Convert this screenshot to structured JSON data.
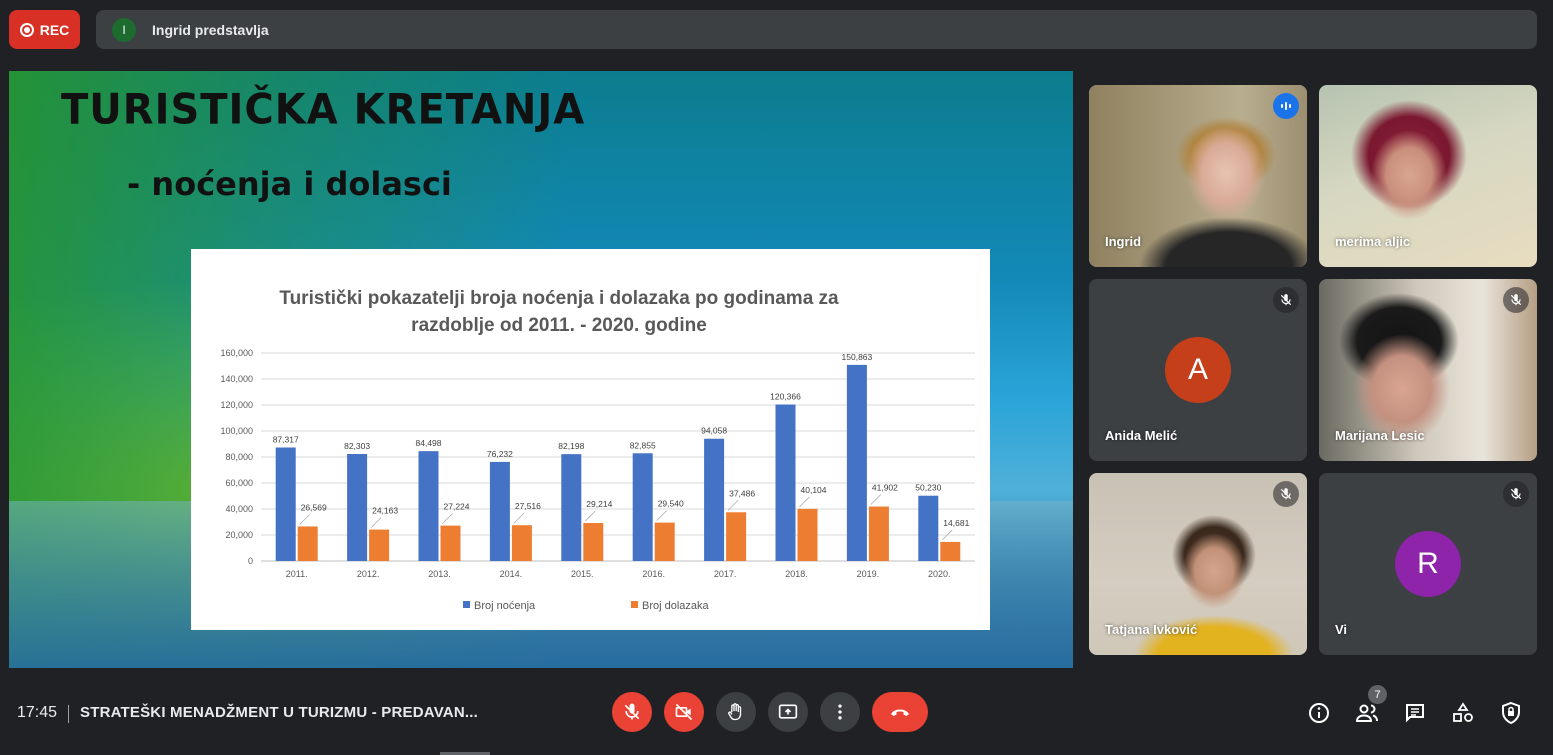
{
  "top": {
    "rec_label": "REC",
    "presenter_initial": "I",
    "presenter_text": "Ingrid predstavlja"
  },
  "slide": {
    "title": "TURISTIČKA KRETANJA",
    "subtitle": "- noćenja i dolasci"
  },
  "chart_data": {
    "type": "bar",
    "title_line1": "Turistički pokazatelji broja noćenja i dolazaka po godinama za",
    "title_line2": "razdoblje od 2011. - 2020. godine",
    "categories": [
      "2011.",
      "2012.",
      "2013.",
      "2014.",
      "2015.",
      "2016.",
      "2017.",
      "2018.",
      "2019.",
      "2020."
    ],
    "series": [
      {
        "name": "Broj noćenja",
        "color": "#4472c4",
        "values": [
          87317,
          82303,
          84498,
          76232,
          82198,
          82855,
          94058,
          120366,
          150863,
          50230
        ]
      },
      {
        "name": "Broj dolazaka",
        "color": "#ed7d31",
        "values": [
          26569,
          24163,
          27224,
          27516,
          29214,
          29540,
          37486,
          40104,
          41902,
          14681
        ]
      }
    ],
    "labels": {
      "Broj noćenja": [
        "87,317",
        "82,303",
        "84,498",
        "76,232",
        "82,198",
        "82,855",
        "94,058",
        "120,366",
        "150,863",
        "50,230"
      ],
      "Broj dolazaka": [
        "26,569",
        "24,163",
        "27,224",
        "27,516",
        "29,214",
        "29,540",
        "37,486",
        "40,104",
        "41,902",
        "14,681"
      ]
    },
    "ylim": [
      0,
      160000
    ],
    "yticks": [
      "0",
      "20,000",
      "40,000",
      "60,000",
      "80,000",
      "100,000",
      "120,000",
      "140,000",
      "160,000"
    ],
    "grid": true,
    "legend": "bottom"
  },
  "participants": [
    {
      "name": "Ingrid",
      "type": "video",
      "speaking": true
    },
    {
      "name": "merima aljic",
      "type": "video"
    },
    {
      "name": "Anida Melić",
      "type": "avatar",
      "initial": "A",
      "color": "#c5401a",
      "muted": true
    },
    {
      "name": "Marijana Lesic",
      "type": "video",
      "muted": true
    },
    {
      "name": "Tatjana Ivković",
      "type": "video",
      "muted": true
    },
    {
      "name": "Vi",
      "type": "avatar",
      "initial": "R",
      "color": "#8e24aa",
      "muted": true
    }
  ],
  "bottom": {
    "time": "17:45",
    "meeting": "STRATEŠKI MENADŽMENT U TURIZMU - PREDAVAN...",
    "people_count": "7"
  },
  "icons": {
    "mic": "mic-off-icon",
    "camera": "camera-off-icon",
    "hand": "raise-hand-icon",
    "present": "present-icon",
    "more": "more-vert-icon",
    "end": "end-call-icon",
    "info": "info-icon",
    "people": "people-icon",
    "chat": "chat-icon",
    "activities": "activities-icon",
    "safety": "host-controls-icon"
  }
}
